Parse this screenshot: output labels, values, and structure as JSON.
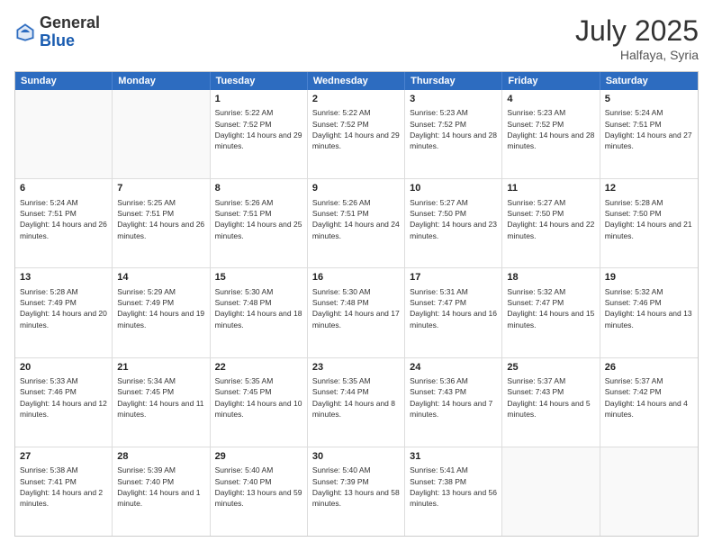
{
  "header": {
    "logo_general": "General",
    "logo_blue": "Blue",
    "month_title": "July 2025",
    "location": "Halfaya, Syria"
  },
  "weekdays": [
    "Sunday",
    "Monday",
    "Tuesday",
    "Wednesday",
    "Thursday",
    "Friday",
    "Saturday"
  ],
  "rows": [
    [
      {
        "date": "",
        "empty": true
      },
      {
        "date": "",
        "empty": true
      },
      {
        "date": "1",
        "sunrise": "Sunrise: 5:22 AM",
        "sunset": "Sunset: 7:52 PM",
        "daylight": "Daylight: 14 hours and 29 minutes."
      },
      {
        "date": "2",
        "sunrise": "Sunrise: 5:22 AM",
        "sunset": "Sunset: 7:52 PM",
        "daylight": "Daylight: 14 hours and 29 minutes."
      },
      {
        "date": "3",
        "sunrise": "Sunrise: 5:23 AM",
        "sunset": "Sunset: 7:52 PM",
        "daylight": "Daylight: 14 hours and 28 minutes."
      },
      {
        "date": "4",
        "sunrise": "Sunrise: 5:23 AM",
        "sunset": "Sunset: 7:52 PM",
        "daylight": "Daylight: 14 hours and 28 minutes."
      },
      {
        "date": "5",
        "sunrise": "Sunrise: 5:24 AM",
        "sunset": "Sunset: 7:51 PM",
        "daylight": "Daylight: 14 hours and 27 minutes."
      }
    ],
    [
      {
        "date": "6",
        "sunrise": "Sunrise: 5:24 AM",
        "sunset": "Sunset: 7:51 PM",
        "daylight": "Daylight: 14 hours and 26 minutes."
      },
      {
        "date": "7",
        "sunrise": "Sunrise: 5:25 AM",
        "sunset": "Sunset: 7:51 PM",
        "daylight": "Daylight: 14 hours and 26 minutes."
      },
      {
        "date": "8",
        "sunrise": "Sunrise: 5:26 AM",
        "sunset": "Sunset: 7:51 PM",
        "daylight": "Daylight: 14 hours and 25 minutes."
      },
      {
        "date": "9",
        "sunrise": "Sunrise: 5:26 AM",
        "sunset": "Sunset: 7:51 PM",
        "daylight": "Daylight: 14 hours and 24 minutes."
      },
      {
        "date": "10",
        "sunrise": "Sunrise: 5:27 AM",
        "sunset": "Sunset: 7:50 PM",
        "daylight": "Daylight: 14 hours and 23 minutes."
      },
      {
        "date": "11",
        "sunrise": "Sunrise: 5:27 AM",
        "sunset": "Sunset: 7:50 PM",
        "daylight": "Daylight: 14 hours and 22 minutes."
      },
      {
        "date": "12",
        "sunrise": "Sunrise: 5:28 AM",
        "sunset": "Sunset: 7:50 PM",
        "daylight": "Daylight: 14 hours and 21 minutes."
      }
    ],
    [
      {
        "date": "13",
        "sunrise": "Sunrise: 5:28 AM",
        "sunset": "Sunset: 7:49 PM",
        "daylight": "Daylight: 14 hours and 20 minutes."
      },
      {
        "date": "14",
        "sunrise": "Sunrise: 5:29 AM",
        "sunset": "Sunset: 7:49 PM",
        "daylight": "Daylight: 14 hours and 19 minutes."
      },
      {
        "date": "15",
        "sunrise": "Sunrise: 5:30 AM",
        "sunset": "Sunset: 7:48 PM",
        "daylight": "Daylight: 14 hours and 18 minutes."
      },
      {
        "date": "16",
        "sunrise": "Sunrise: 5:30 AM",
        "sunset": "Sunset: 7:48 PM",
        "daylight": "Daylight: 14 hours and 17 minutes."
      },
      {
        "date": "17",
        "sunrise": "Sunrise: 5:31 AM",
        "sunset": "Sunset: 7:47 PM",
        "daylight": "Daylight: 14 hours and 16 minutes."
      },
      {
        "date": "18",
        "sunrise": "Sunrise: 5:32 AM",
        "sunset": "Sunset: 7:47 PM",
        "daylight": "Daylight: 14 hours and 15 minutes."
      },
      {
        "date": "19",
        "sunrise": "Sunrise: 5:32 AM",
        "sunset": "Sunset: 7:46 PM",
        "daylight": "Daylight: 14 hours and 13 minutes."
      }
    ],
    [
      {
        "date": "20",
        "sunrise": "Sunrise: 5:33 AM",
        "sunset": "Sunset: 7:46 PM",
        "daylight": "Daylight: 14 hours and 12 minutes."
      },
      {
        "date": "21",
        "sunrise": "Sunrise: 5:34 AM",
        "sunset": "Sunset: 7:45 PM",
        "daylight": "Daylight: 14 hours and 11 minutes."
      },
      {
        "date": "22",
        "sunrise": "Sunrise: 5:35 AM",
        "sunset": "Sunset: 7:45 PM",
        "daylight": "Daylight: 14 hours and 10 minutes."
      },
      {
        "date": "23",
        "sunrise": "Sunrise: 5:35 AM",
        "sunset": "Sunset: 7:44 PM",
        "daylight": "Daylight: 14 hours and 8 minutes."
      },
      {
        "date": "24",
        "sunrise": "Sunrise: 5:36 AM",
        "sunset": "Sunset: 7:43 PM",
        "daylight": "Daylight: 14 hours and 7 minutes."
      },
      {
        "date": "25",
        "sunrise": "Sunrise: 5:37 AM",
        "sunset": "Sunset: 7:43 PM",
        "daylight": "Daylight: 14 hours and 5 minutes."
      },
      {
        "date": "26",
        "sunrise": "Sunrise: 5:37 AM",
        "sunset": "Sunset: 7:42 PM",
        "daylight": "Daylight: 14 hours and 4 minutes."
      }
    ],
    [
      {
        "date": "27",
        "sunrise": "Sunrise: 5:38 AM",
        "sunset": "Sunset: 7:41 PM",
        "daylight": "Daylight: 14 hours and 2 minutes."
      },
      {
        "date": "28",
        "sunrise": "Sunrise: 5:39 AM",
        "sunset": "Sunset: 7:40 PM",
        "daylight": "Daylight: 14 hours and 1 minute."
      },
      {
        "date": "29",
        "sunrise": "Sunrise: 5:40 AM",
        "sunset": "Sunset: 7:40 PM",
        "daylight": "Daylight: 13 hours and 59 minutes."
      },
      {
        "date": "30",
        "sunrise": "Sunrise: 5:40 AM",
        "sunset": "Sunset: 7:39 PM",
        "daylight": "Daylight: 13 hours and 58 minutes."
      },
      {
        "date": "31",
        "sunrise": "Sunrise: 5:41 AM",
        "sunset": "Sunset: 7:38 PM",
        "daylight": "Daylight: 13 hours and 56 minutes."
      },
      {
        "date": "",
        "empty": true
      },
      {
        "date": "",
        "empty": true
      }
    ]
  ]
}
